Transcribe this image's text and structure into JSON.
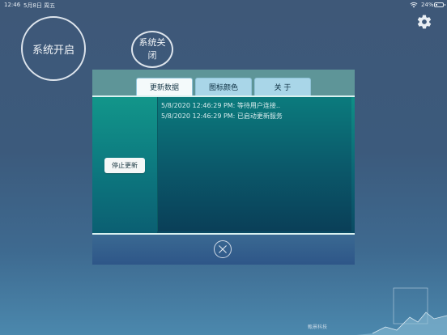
{
  "status_bar": {
    "time": "12:46",
    "date": "5月8日 周五",
    "battery_percent": "24%",
    "battery_level": 0.24
  },
  "controls": {
    "system_start": "系统开启",
    "system_stop": "系统关闭"
  },
  "icons": {
    "settings": "gear-icon",
    "close": "close-circle-icon",
    "wifi": "wifi-icon",
    "battery": "battery-icon",
    "watermark": "mountain-icon"
  },
  "tabs": [
    {
      "label": "更新数据",
      "active": true
    },
    {
      "label": "图标颜色",
      "active": false
    },
    {
      "label": "关 于",
      "active": false
    }
  ],
  "update_panel": {
    "stop_update_label": "停止更新",
    "log": [
      "5/8/2020 12:46:29 PM: 等待用户连接..",
      "5/8/2020 12:46:29 PM: 已启动更新服务"
    ]
  },
  "brand": "甄景科技",
  "colors": {
    "accent_teal": "#0f8f86",
    "tab_inactive": "#a9d6e8",
    "tab_active": "#f4fafb"
  }
}
